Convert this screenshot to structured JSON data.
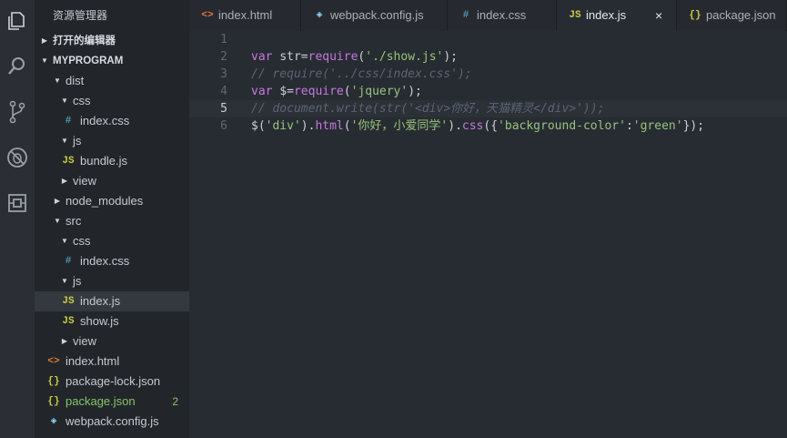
{
  "explorer": {
    "title": "资源管理器",
    "open_editors": "打开的编辑器",
    "project": "MYPROGRAM",
    "items": [
      {
        "label": "dist",
        "depth": 1,
        "type": "folder",
        "open": true
      },
      {
        "label": "css",
        "depth": 2,
        "type": "folder",
        "open": true
      },
      {
        "label": "index.css",
        "depth": 3,
        "type": "css"
      },
      {
        "label": "js",
        "depth": 2,
        "type": "folder",
        "open": true
      },
      {
        "label": "bundle.js",
        "depth": 3,
        "type": "js"
      },
      {
        "label": "view",
        "depth": 2,
        "type": "folder",
        "open": false
      },
      {
        "label": "node_modules",
        "depth": 1,
        "type": "folder",
        "open": false
      },
      {
        "label": "src",
        "depth": 1,
        "type": "folder",
        "open": true
      },
      {
        "label": "css",
        "depth": 2,
        "type": "folder",
        "open": true
      },
      {
        "label": "index.css",
        "depth": 3,
        "type": "css"
      },
      {
        "label": "js",
        "depth": 2,
        "type": "folder",
        "open": true
      },
      {
        "label": "index.js",
        "depth": 3,
        "type": "js",
        "active": true
      },
      {
        "label": "show.js",
        "depth": 3,
        "type": "js"
      },
      {
        "label": "view",
        "depth": 2,
        "type": "folder",
        "open": false
      },
      {
        "label": "index.html",
        "depth": 1,
        "type": "html"
      },
      {
        "label": "package-lock.json",
        "depth": 1,
        "type": "json"
      },
      {
        "label": "package.json",
        "depth": 1,
        "type": "json",
        "modified": true,
        "badge": "2"
      },
      {
        "label": "webpack.config.js",
        "depth": 1,
        "type": "webpack"
      }
    ]
  },
  "tabs": [
    {
      "label": "index.html",
      "type": "html"
    },
    {
      "label": "webpack.config.js",
      "type": "webpack"
    },
    {
      "label": "index.css",
      "type": "css"
    },
    {
      "label": "index.js",
      "type": "js",
      "active": true,
      "close": "×"
    },
    {
      "label": "package.json",
      "type": "json"
    }
  ],
  "icons": {
    "html": "<>",
    "css": "#",
    "js": "JS",
    "json": "{}",
    "webpack": "◈",
    "folder_open": "▼",
    "folder_closed": "▶"
  },
  "colors": {
    "keyword": "#c678dd",
    "string": "#98c379",
    "comment": "#5c6370",
    "plain": "#c9d1d9",
    "html_icon": "#e37933",
    "css_icon": "#519aba",
    "js_icon": "#cbcb41",
    "json_icon": "#cbcb41",
    "webpack_icon": "#8ed6fb"
  },
  "editor": {
    "current_line": 5,
    "lines": [
      {
        "n": "1",
        "tokens": []
      },
      {
        "n": "2",
        "tokens": [
          {
            "t": "var ",
            "c": "keyword"
          },
          {
            "t": "str",
            "c": "plain"
          },
          {
            "t": "=",
            "c": "plain"
          },
          {
            "t": "require",
            "c": "keyword"
          },
          {
            "t": "(",
            "c": "plain"
          },
          {
            "t": "'./show.js'",
            "c": "string"
          },
          {
            "t": ");",
            "c": "plain"
          }
        ]
      },
      {
        "n": "3",
        "tokens": [
          {
            "t": "// require('../css/index.css');",
            "c": "comment"
          }
        ]
      },
      {
        "n": "4",
        "tokens": [
          {
            "t": "var ",
            "c": "keyword"
          },
          {
            "t": "$",
            "c": "plain"
          },
          {
            "t": "=",
            "c": "plain"
          },
          {
            "t": "require",
            "c": "keyword"
          },
          {
            "t": "(",
            "c": "plain"
          },
          {
            "t": "'jquery'",
            "c": "string"
          },
          {
            "t": ");",
            "c": "plain"
          }
        ]
      },
      {
        "n": "5",
        "tokens": [
          {
            "t": "// document.write(str('<div>你好，天猫精灵</div>'));",
            "c": "comment"
          }
        ]
      },
      {
        "n": "6",
        "tokens": [
          {
            "t": "$(",
            "c": "plain"
          },
          {
            "t": "'div'",
            "c": "string"
          },
          {
            "t": ").",
            "c": "plain"
          },
          {
            "t": "html",
            "c": "keyword"
          },
          {
            "t": "(",
            "c": "plain"
          },
          {
            "t": "'你好，小爱同学'",
            "c": "string"
          },
          {
            "t": ").",
            "c": "plain"
          },
          {
            "t": "css",
            "c": "keyword"
          },
          {
            "t": "({",
            "c": "plain"
          },
          {
            "t": "'background-color'",
            "c": "string"
          },
          {
            "t": ":",
            "c": "plain"
          },
          {
            "t": "'green'",
            "c": "string"
          },
          {
            "t": "});",
            "c": "plain"
          }
        ]
      }
    ]
  }
}
